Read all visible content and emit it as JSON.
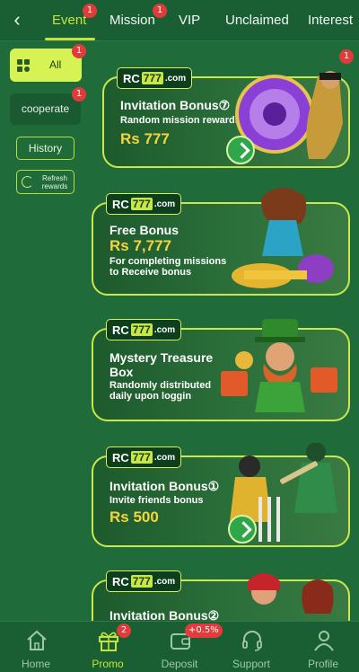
{
  "header": {
    "back_icon": "chevron-left-icon",
    "tabs": [
      {
        "label": "Event",
        "badge": "1",
        "active": true
      },
      {
        "label": "Mission",
        "badge": "1"
      },
      {
        "label": "VIP"
      },
      {
        "label": "Unclaimed"
      },
      {
        "label": "Interest"
      }
    ]
  },
  "sidebar": {
    "all_label": "All",
    "all_badge": "1",
    "cooperate_label": "cooperate",
    "cooperate_badge": "1",
    "history_label": "History",
    "refresh_label": "Refresh rewards"
  },
  "top_right_badge": "1",
  "cards": [
    {
      "logo_rc": "RC",
      "logo_num": "777",
      "logo_com": ".com",
      "title": "Invitation Bonus⑦",
      "desc": "Random mission rewards",
      "amount": "Rs 777"
    },
    {
      "logo_rc": "RC",
      "logo_num": "777",
      "logo_com": ".com",
      "title": "Free Bonus",
      "amount": "Rs 7,777",
      "desc": "For completing missions to Receive bonus"
    },
    {
      "logo_rc": "RC",
      "logo_num": "777",
      "logo_com": ".com",
      "title": "Mystery Treasure Box",
      "desc": "Randomly distributed daily upon loggin"
    },
    {
      "logo_rc": "RC",
      "logo_num": "777",
      "logo_com": ".com",
      "title": "Invitation Bonus①",
      "desc": "Invite friends bonus",
      "amount": "Rs 500"
    },
    {
      "logo_rc": "RC",
      "logo_num": "777",
      "logo_com": ".com",
      "title": "Invitation Bonus②"
    }
  ],
  "bottom_nav": [
    {
      "label": "Home",
      "icon": "home-icon"
    },
    {
      "label": "Promo",
      "icon": "gift-icon",
      "badge": "2",
      "active": true
    },
    {
      "label": "Deposit",
      "icon": "wallet-icon",
      "badge": "+0.5%"
    },
    {
      "label": "Support",
      "icon": "headset-icon"
    },
    {
      "label": "Profile",
      "icon": "user-icon"
    }
  ],
  "colors": {
    "background": "#1f6b3a",
    "accent": "#c5e33a",
    "badge": "#e23b3b",
    "amount": "#f6d43d"
  }
}
